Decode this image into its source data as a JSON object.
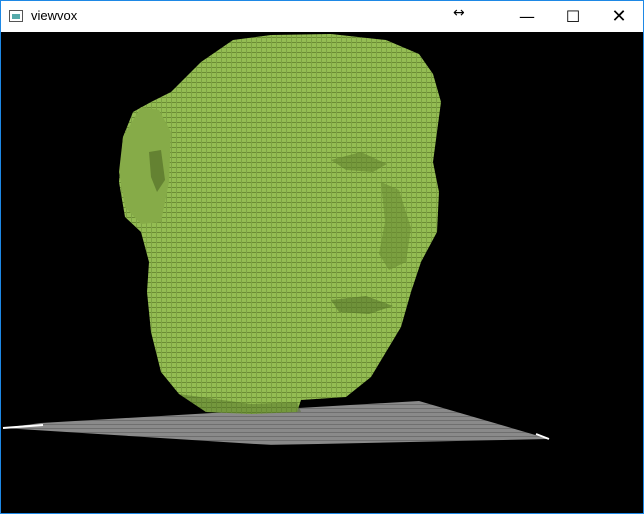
{
  "window": {
    "title": "viewvox",
    "icons": {
      "app": "app-icon",
      "resize": "resize-cursor-icon",
      "minimize": "minimize-icon",
      "maximize": "maximize-icon",
      "close": "close-icon"
    },
    "glyphs": {
      "resize": "↔",
      "minimize": "—",
      "maximize": "☐",
      "close": "✕"
    }
  },
  "scene": {
    "subject": "voxelized head",
    "colors": {
      "background": "#000000",
      "voxel_fill": "#94bd53",
      "voxel_shade": "#6b8d34",
      "ground": "#888888"
    }
  }
}
